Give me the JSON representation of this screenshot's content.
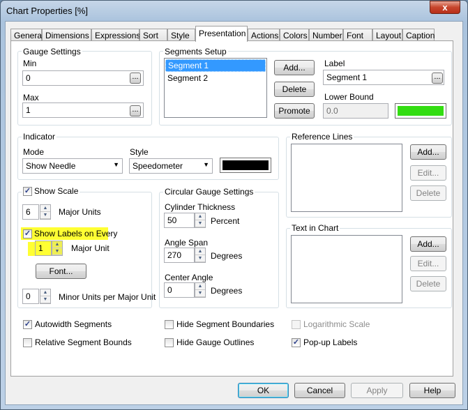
{
  "window": {
    "title": "Chart Properties [%]",
    "close": "x"
  },
  "tabs": [
    "General",
    "Dimensions",
    "Expressions",
    "Sort",
    "Style",
    "Presentation",
    "Actions",
    "Colors",
    "Number",
    "Font",
    "Layout",
    "Caption"
  ],
  "active_tab": "Presentation",
  "gauge_settings": {
    "title": "Gauge Settings",
    "min_label": "Min",
    "min_value": "0",
    "max_label": "Max",
    "max_value": "1",
    "browse": "..."
  },
  "segments_setup": {
    "title": "Segments Setup",
    "segments": [
      "Segment 1",
      "Segment 2"
    ],
    "selected": "Segment 1",
    "add": "Add...",
    "delete": "Delete",
    "promote": "Promote",
    "label_label": "Label",
    "label_value": "Segment 1",
    "lower_bound_label": "Lower Bound",
    "lower_bound_value": "0.0",
    "color": "#33dd11"
  },
  "indicator": {
    "title": "Indicator",
    "mode_label": "Mode",
    "mode_value": "Show Needle",
    "style_label": "Style",
    "style_value": "Speedometer",
    "color": "#000000"
  },
  "reference_lines": {
    "title": "Reference Lines",
    "add": "Add...",
    "edit": "Edit...",
    "delete": "Delete"
  },
  "show_scale": {
    "label": "Show Scale",
    "checked": true,
    "major_units_value": "6",
    "major_units_label": "Major Units",
    "show_labels_label": "Show Labels on Every",
    "show_labels_checked": true,
    "labels_every_value": "1",
    "major_unit_label": "Major Unit",
    "font_button": "Font...",
    "minor_units_value": "0",
    "minor_units_label": "Minor Units per Major Unit",
    "highlight_color": "#ffff33"
  },
  "circular": {
    "title": "Circular Gauge Settings",
    "cyl_label": "Cylinder Thickness",
    "cyl_value": "50",
    "cyl_unit": "Percent",
    "angle_label": "Angle Span",
    "angle_value": "270",
    "angle_unit": "Degrees",
    "center_label": "Center Angle",
    "center_value": "0",
    "center_unit": "Degrees"
  },
  "text_in_chart": {
    "title": "Text in Chart",
    "add": "Add...",
    "edit": "Edit...",
    "delete": "Delete"
  },
  "options": {
    "autowidth": "Autowidth Segments",
    "autowidth_checked": true,
    "relative": "Relative Segment Bounds",
    "relative_checked": false,
    "hide_boundaries": "Hide Segment Boundaries",
    "hide_boundaries_checked": false,
    "hide_outlines": "Hide Gauge Outlines",
    "hide_outlines_checked": false,
    "log_scale": "Logarithmic Scale",
    "log_scale_checked": false,
    "popup": "Pop-up Labels",
    "popup_checked": true
  },
  "footer": {
    "ok": "OK",
    "cancel": "Cancel",
    "apply": "Apply",
    "help": "Help"
  }
}
